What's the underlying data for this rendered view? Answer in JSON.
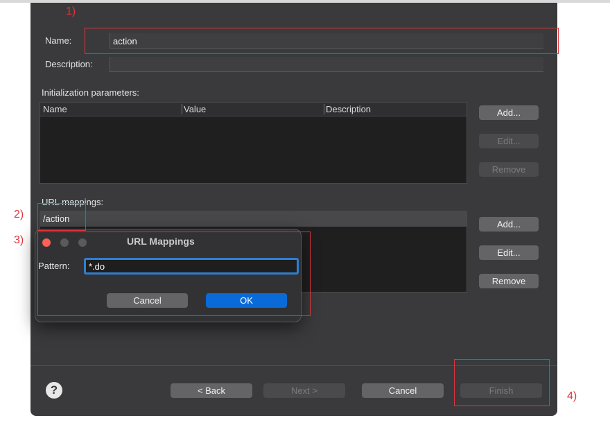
{
  "annotations": {
    "a1": "1)",
    "a2": "2)",
    "a3": "3)",
    "a4": "4)"
  },
  "form": {
    "name_label": "Name:",
    "name_value": "action",
    "description_label": "Description:",
    "description_value": ""
  },
  "init_params": {
    "title": "Initialization parameters:",
    "columns": [
      "Name",
      "Value",
      "Description"
    ],
    "buttons": {
      "add": "Add...",
      "edit": "Edit...",
      "remove": "Remove"
    }
  },
  "url_mappings": {
    "title": "URL mappings:",
    "rows": [
      "/action"
    ],
    "buttons": {
      "add": "Add...",
      "edit": "Edit...",
      "remove": "Remove"
    }
  },
  "modal": {
    "title": "URL Mappings",
    "pattern_label": "Pattern:",
    "pattern_value": "*.do",
    "cancel": "Cancel",
    "ok": "OK"
  },
  "footer": {
    "help": "?",
    "back": "< Back",
    "next": "Next >",
    "cancel": "Cancel",
    "finish": "Finish"
  },
  "colors": {
    "dialog_bg": "#3a3a3c",
    "annotation_red": "#e0343a",
    "accent_blue": "#0a6bd8",
    "close_red": "#ff5f57"
  }
}
